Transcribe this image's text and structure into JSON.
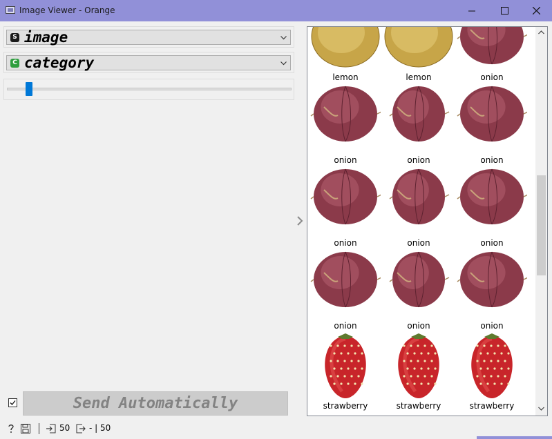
{
  "window": {
    "title": "Image Viewer - Orange",
    "accent": "#9190d8",
    "controls": [
      "minimize-icon",
      "maximize-icon",
      "close-icon"
    ]
  },
  "controls": {
    "image_attribute": {
      "badge": "S",
      "badge_color": "#1a1a1a",
      "value": "image"
    },
    "title_attribute": {
      "badge": "C",
      "badge_color": "#2e9e3e",
      "value": "category"
    },
    "zoom_slider": {
      "level": 0.07,
      "handle_color": "#0078d7"
    }
  },
  "viewer": {
    "items": [
      {
        "label": "lemon",
        "kind": "lemon",
        "cropped": true
      },
      {
        "label": "lemon",
        "kind": "lemon",
        "cropped": true
      },
      {
        "label": "onion",
        "kind": "onion",
        "cropped": true
      },
      {
        "label": "onion",
        "kind": "onion"
      },
      {
        "label": "onion",
        "kind": "onion"
      },
      {
        "label": "onion",
        "kind": "onion"
      },
      {
        "label": "onion",
        "kind": "onion"
      },
      {
        "label": "onion",
        "kind": "onion"
      },
      {
        "label": "onion",
        "kind": "onion"
      },
      {
        "label": "onion",
        "kind": "onion"
      },
      {
        "label": "onion",
        "kind": "onion"
      },
      {
        "label": "onion",
        "kind": "onion"
      },
      {
        "label": "strawberry",
        "kind": "strawberry"
      },
      {
        "label": "strawberry",
        "kind": "strawberry"
      },
      {
        "label": "strawberry",
        "kind": "strawberry"
      }
    ]
  },
  "footer": {
    "send_automatically_checked": true,
    "send_button_label": "Send Automatically",
    "input_count": "50",
    "output_count": "- | 50",
    "icons": [
      "help-icon",
      "save-icon",
      "input-icon",
      "output-icon"
    ]
  }
}
